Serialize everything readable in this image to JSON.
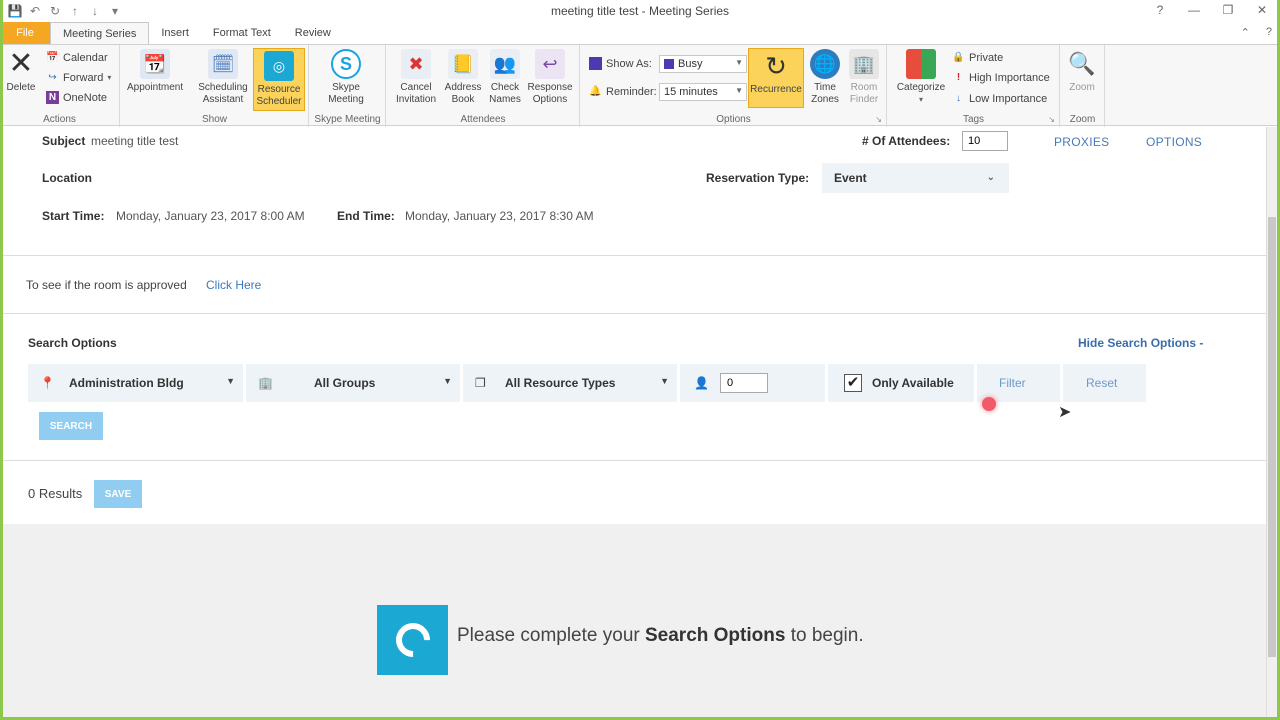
{
  "window": {
    "title": "meeting title test - Meeting Series"
  },
  "tabs": [
    {
      "label": "File"
    },
    {
      "label": "Meeting Series"
    },
    {
      "label": "Insert"
    },
    {
      "label": "Format Text"
    },
    {
      "label": "Review"
    }
  ],
  "ribbon": {
    "actions": {
      "group_label": "Actions",
      "delete": "Delete",
      "calendar": "Calendar",
      "forward": "Forward",
      "onenote": "OneNote"
    },
    "show": {
      "group_label": "Show",
      "appointment": "Appointment",
      "scheduling_assistant": "Scheduling Assistant",
      "resource_scheduler": "Resource Scheduler"
    },
    "skype": {
      "group_label": "Skype Meeting",
      "skype_meeting": "Skype Meeting"
    },
    "attendees": {
      "group_label": "Attendees",
      "cancel_invitation": "Cancel Invitation",
      "address_book": "Address Book",
      "check_names": "Check Names",
      "response_options": "Response Options"
    },
    "options": {
      "group_label": "Options",
      "show_as_label": "Show As:",
      "show_as_value": "Busy",
      "reminder_label": "Reminder:",
      "reminder_value": "15 minutes",
      "recurrence": "Recurrence",
      "time_zones": "Time Zones",
      "room_finder": "Room Finder"
    },
    "tags": {
      "group_label": "Tags",
      "categorize": "Categorize",
      "private": "Private",
      "high_importance": "High Importance",
      "low_importance": "Low Importance"
    },
    "zoom": {
      "group_label": "Zoom",
      "zoom": "Zoom"
    }
  },
  "form": {
    "subject_label": "Subject",
    "subject_value": "meeting title test",
    "attendees_label": "# Of Attendees:",
    "attendees_value": "10",
    "proxies": "PROXIES",
    "options": "OPTIONS",
    "location_label": "Location",
    "reservation_type_label": "Reservation Type:",
    "reservation_type_value": "Event",
    "start_time_label": "Start Time:",
    "start_time_value": "Monday, January 23, 2017 8:00 AM",
    "end_time_label": "End Time:",
    "end_time_value": "Monday, January 23, 2017 8:30 AM",
    "approval_text": "To see if the room is approved",
    "approval_link": "Click Here"
  },
  "search": {
    "title": "Search Options",
    "hide_link": "Hide Search Options -",
    "building": "Administration Bldg",
    "groups": "All Groups",
    "resource_types": "All Resource Types",
    "capacity": "0",
    "only_available": "Only Available",
    "filter": "Filter",
    "reset": "Reset",
    "search_button": "SEARCH"
  },
  "results": {
    "count_text": "0 Results",
    "save_button": "SAVE"
  },
  "empty_state": {
    "prefix": "Please complete your",
    "bold": "Search Options",
    "suffix": "to begin."
  }
}
